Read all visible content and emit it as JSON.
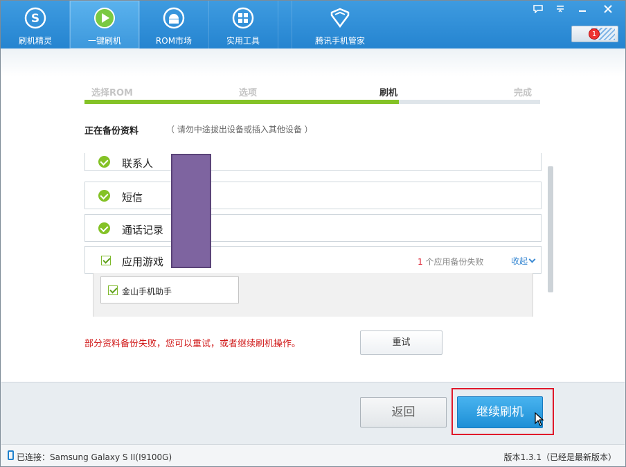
{
  "top_tabs": [
    {
      "label": "刷机精灵",
      "icon": "s-logo-icon"
    },
    {
      "label": "一键刷机",
      "icon": "play-icon",
      "active": true
    },
    {
      "label": "ROM市场",
      "icon": "android-icon"
    },
    {
      "label": "实用工具",
      "icon": "grid-icon"
    },
    {
      "label": "腾讯手机管家",
      "icon": "shield-icon"
    }
  ],
  "notification_count": "1",
  "steps": [
    "选择ROM",
    "选项",
    "刷机",
    "完成"
  ],
  "current_step": "刷机",
  "progress_fraction": 0.69,
  "section_title": "正在备份资料",
  "section_note": "（ 请勿中途拔出设备或插入其他设备 ）",
  "backup_items": [
    {
      "label": "联系人",
      "status": "done"
    },
    {
      "label": "短信",
      "status": "done"
    },
    {
      "label": "通话记录",
      "status": "done"
    }
  ],
  "app_group": {
    "label": "应用游戏",
    "fail_count": "1",
    "fail_text": "个应用备份失败",
    "collapse_label": "收起",
    "apps": [
      "金山手机助手"
    ]
  },
  "warning": "部分资料备份失败，您可以重试，或者继续刷机操作。",
  "retry_label": "重试",
  "back_label": "返回",
  "continue_label": "继续刷机",
  "status_connected": "已连接：Samsung Galaxy S II(I9100G)",
  "status_version": "版本1.3.1（已经是最新版本）",
  "colors": {
    "accent": "#2584d0",
    "progress": "#84c226",
    "warning": "#d01818",
    "highlight": "#e0182a"
  }
}
